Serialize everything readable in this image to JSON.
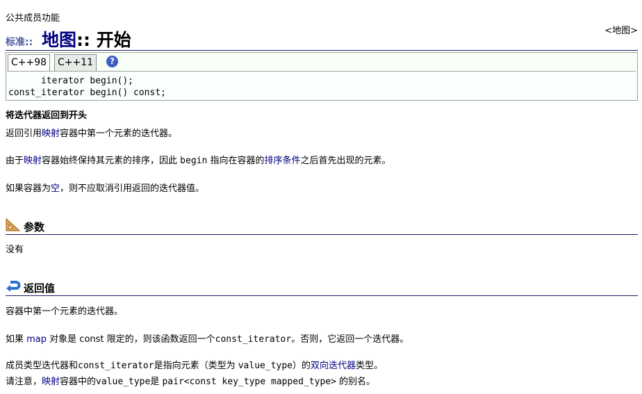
{
  "header": {
    "category": "公共成员功能",
    "namespace": "标准::",
    "title_link": "地图",
    "title_rest": "::  开始",
    "back_link": "<地图>"
  },
  "versions": {
    "tab1": "C++98",
    "tab2": "C++11",
    "help_icon": "?"
  },
  "code": {
    "line1": "      iterator begin();",
    "line2": "const_iterator begin() const;"
  },
  "summary": "将迭代器返回到开头",
  "desc1": {
    "a": "返回引用",
    "link": "映射",
    "b": "容器中第一个元素的迭代器。"
  },
  "desc2": {
    "a": "由于",
    "link1": "映射",
    "b": "容器始终保持其元素的排序，因此 ",
    "code": "begin",
    "c": " 指向在容器的",
    "link2": "排序条件",
    "d": "之后首先出现的元素。"
  },
  "desc3": {
    "a": "如果容器为",
    "link": "空",
    "b": "，则不应取消引用返回的迭代器值。"
  },
  "params": {
    "heading": "参数",
    "text": "没有"
  },
  "returns": {
    "heading": "返回值",
    "line1": "容器中第一个元素的迭代器。",
    "line2": {
      "a": "如果 ",
      "link": "map",
      "b": " 对象是 const 限定的，则该函数返回一个",
      "code": "const_iterator",
      "c": "。否则，它返回一个迭代器。"
    },
    "line3": {
      "a": "成员类型迭代器和",
      "code1": "const_iterator",
      "b": "是指向元素（类型为 ",
      "code2": "value_type",
      "c": "）的",
      "link": "双向迭代器",
      "d": "类型。"
    },
    "line4": {
      "a": "请注意，",
      "link": "映射",
      "b": "容器中的",
      "code1": "value_type",
      "c": "是 ",
      "code2": "pair<const key_type mapped_type>",
      "d": " 的别名。"
    }
  }
}
